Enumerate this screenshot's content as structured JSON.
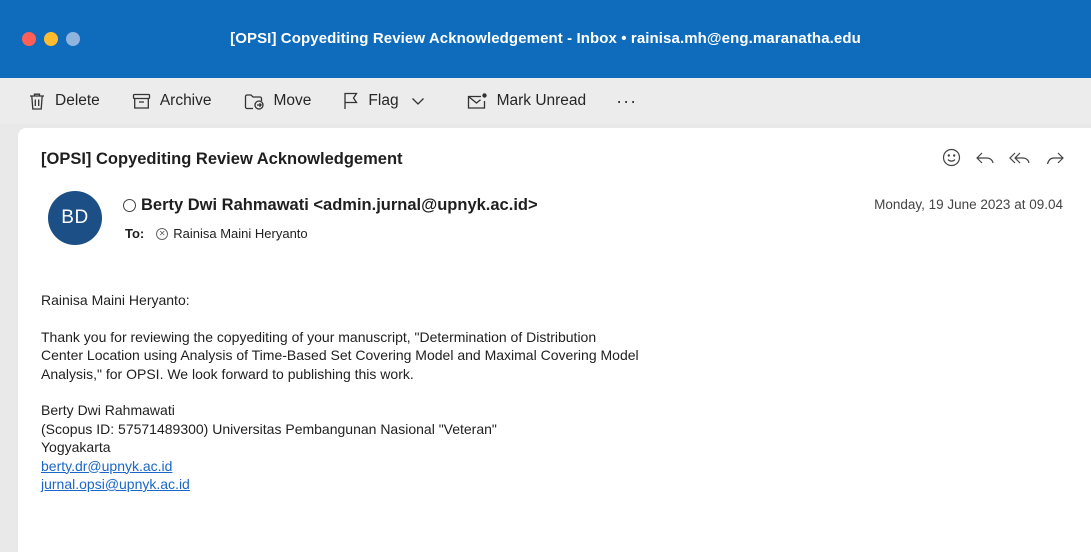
{
  "window": {
    "title": "[OPSI] Copyediting Review Acknowledgement - Inbox • rainisa.mh@eng.maranatha.edu"
  },
  "toolbar": {
    "delete": "Delete",
    "archive": "Archive",
    "move": "Move",
    "flag": "Flag",
    "mark_unread": "Mark Unread",
    "more": "···"
  },
  "message": {
    "subject": "[OPSI] Copyediting Review Acknowledgement",
    "avatar_initials": "BD",
    "sender": "Berty Dwi Rahmawati <admin.jurnal@upnyk.ac.id>",
    "to_label": "To:",
    "recipient": "Rainisa Maini Heryanto",
    "date": "Monday, 19 June 2023 at 09.04",
    "greeting": "Rainisa Maini Heryanto:",
    "paragraph": "Thank you for reviewing the copyediting of your manuscript, \"Determination of Distribution Center Location using Analysis of Time-Based Set Covering Model and Maximal Covering Model Analysis,\" for OPSI. We look forward to publishing this work.",
    "signature": {
      "name": "Berty Dwi Rahmawati",
      "affiliation_line1": "(Scopus ID: 57571489300) Universitas Pembangunan Nasional \"Veteran\"",
      "affiliation_line2": "Yogyakarta",
      "email1": "berty.dr@upnyk.ac.id",
      "email2": "jurnal.opsi@upnyk.ac.id"
    }
  },
  "colors": {
    "titlebar": "#0f6cbd",
    "avatar": "#1b4f86",
    "link": "#1a66c9"
  }
}
